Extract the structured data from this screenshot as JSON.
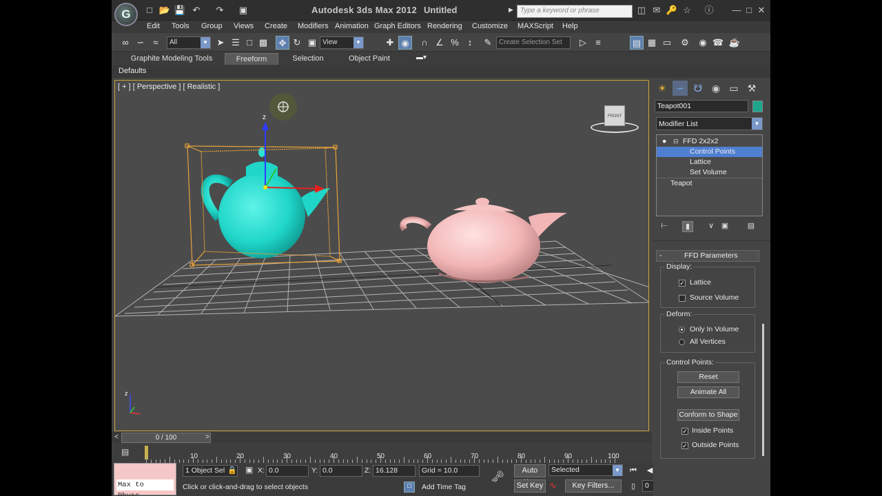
{
  "app": {
    "title": "Autodesk 3ds Max  2012",
    "document": "Untitled",
    "logo": "G"
  },
  "search": {
    "placeholder": "Type a keyword or phrase"
  },
  "menu": [
    "Edit",
    "Tools",
    "Group",
    "Views",
    "Create",
    "Modifiers",
    "Animation",
    "Graph Editors",
    "Rendering",
    "Customize",
    "MAXScript",
    "Help"
  ],
  "toolbar": {
    "selection_filter": "All",
    "ref_coord": "View",
    "named_selection_placeholder": "Create Selection Set"
  },
  "ribbon": {
    "tabs": [
      "Graphite Modeling Tools",
      "Freeform",
      "Selection",
      "Object Paint"
    ],
    "active_tab": "Freeform",
    "panel_label": "Defaults"
  },
  "viewport": {
    "label": "[ + ] [ Perspective ] [ Realistic ]",
    "viewcube_face": "FRONT",
    "axis_z": "z",
    "axis_x": "x",
    "axis_y": "y"
  },
  "timeline": {
    "frame_display": "0 / 100",
    "ticks": [
      "10",
      "20",
      "30",
      "40",
      "50",
      "60",
      "70",
      "80",
      "90",
      "100"
    ]
  },
  "status": {
    "maxscript_text": "Max to Physc.",
    "selection_info": "1 Object Sel",
    "x_label": "X:",
    "x_value": "0.0",
    "y_label": "Y:",
    "y_value": "0.0",
    "z_label": "Z:",
    "z_value": "16.128",
    "grid": "Grid = 10.0",
    "prompt": "Click or click-and-drag to select objects",
    "add_time_tag": "Add Time Tag",
    "auto_key": "Auto Key",
    "set_key": "Set Key",
    "key_mode": "Selected",
    "key_filters": "Key Filters...",
    "current_frame": "0"
  },
  "command_panel": {
    "object_name": "Teapot001",
    "object_color": "#1ea58c",
    "modifier_list": "Modifier List",
    "stack": [
      "FFD 2x2x2",
      "Control Points",
      "Lattice",
      "Set Volume",
      "Teapot"
    ],
    "selected_stack_item": "Control Points",
    "rollout_title": "FFD Parameters",
    "display_group": "Display:",
    "lattice": "Lattice",
    "source_volume": "Source Volume",
    "deform_group": "Deform:",
    "only_in_volume": "Only In Volume",
    "all_vertices": "All Vertices",
    "control_points_group": "Control Points:",
    "reset": "Reset",
    "animate_all": "Animate All",
    "conform_to_shape": "Conform to Shape",
    "inside_points": "Inside Points",
    "outside_points": "Outside Points"
  },
  "colors": {
    "accent_selection": "#4f7fd0",
    "viewport_border": "#c8a63a",
    "teapot_selected": "#1fd6c8",
    "teapot_other": "#f2b6b6"
  }
}
